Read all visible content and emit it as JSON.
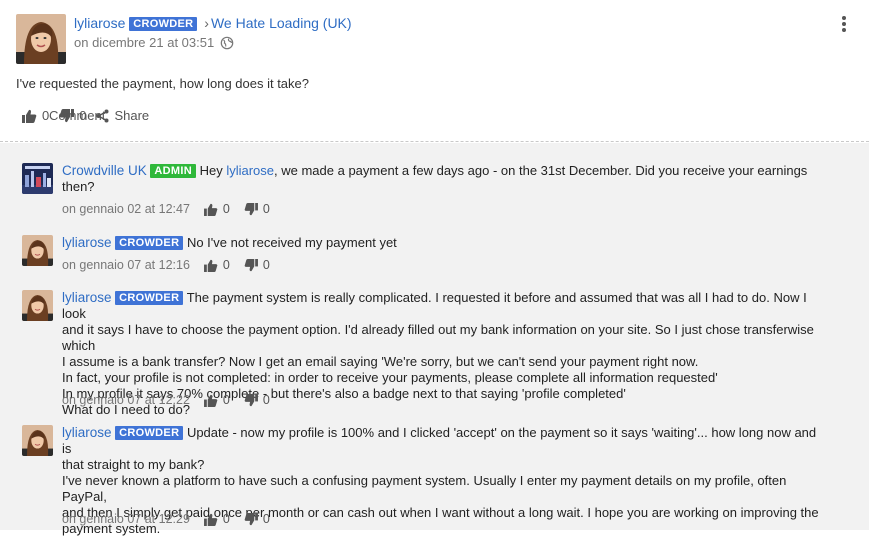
{
  "post": {
    "author": "lyliarose",
    "author_badge": "CROWDER",
    "breadcrumb_sep": "›",
    "group": "We Hate Loading (UK)",
    "timestamp": "on dicembre 21 at 03:51",
    "text": "I've requested the payment, how long does it take?",
    "actions": {
      "comment_label": "Comment",
      "likes": "0",
      "dislikes": "0",
      "share_label": "Share"
    }
  },
  "comments": [
    {
      "author": "Crowdville UK",
      "badge": "ADMIN",
      "lines": [
        "Hey ",
        "lyliarose",
        ", we made a payment a few days ago - on the 31st December. Did you receive your earnings",
        "then?"
      ],
      "timestamp": "on gennaio 02 at 12:47",
      "likes": "0",
      "dislikes": "0"
    },
    {
      "author": "lyliarose",
      "badge": "CROWDER",
      "lines": [
        "No I've not received my payment yet"
      ],
      "timestamp": "on gennaio 07 at 12:16",
      "likes": "0",
      "dislikes": "0"
    },
    {
      "author": "lyliarose",
      "badge": "CROWDER",
      "lines": [
        "The payment system is really complicated. I requested it before and assumed that was all I had to do. Now I look",
        "and it says I have to choose the payment option. I'd already filled out my bank information on your site. So I just chose transferwise which",
        "I assume is a bank transfer? Now I get an email saying 'We're sorry, but we can't send your payment right now.",
        "In fact, your profile is not completed: in order to receive your payments, please complete all information requested'",
        "In my profile it says 70% complete - but there's also a badge next to that saying 'profile completed'",
        "What do I need to do?"
      ],
      "timestamp": "on gennaio 07 at 12:22",
      "likes": "0",
      "dislikes": "0"
    },
    {
      "author": "lyliarose",
      "badge": "CROWDER",
      "lines": [
        "Update - now my profile is 100% and I clicked 'accept' on the payment so it says 'waiting'... how long now and is",
        "that straight to my bank?",
        "I've never known a platform to have such a confusing payment system. Usually I enter my payment details on my profile, often PayPal,",
        "and then I simply get paid once per month or can cash out when I want without a long wait. I hope you are working on improving the",
        "payment system."
      ],
      "timestamp": "on gennaio 07 at 12:29",
      "likes": "0",
      "dislikes": "0"
    }
  ],
  "icons": {
    "globe": "globe-icon",
    "comment": "comment-icon",
    "thumbs_up": "thumbs-up-icon",
    "thumbs_down": "thumbs-down-icon",
    "share": "share-icon",
    "more": "kebab-menu-icon"
  },
  "colors": {
    "link": "#2f6dc4",
    "crowder_badge": "#3f73d6",
    "admin_badge": "#2fb83a",
    "comments_bg": "#f2f2f2"
  }
}
